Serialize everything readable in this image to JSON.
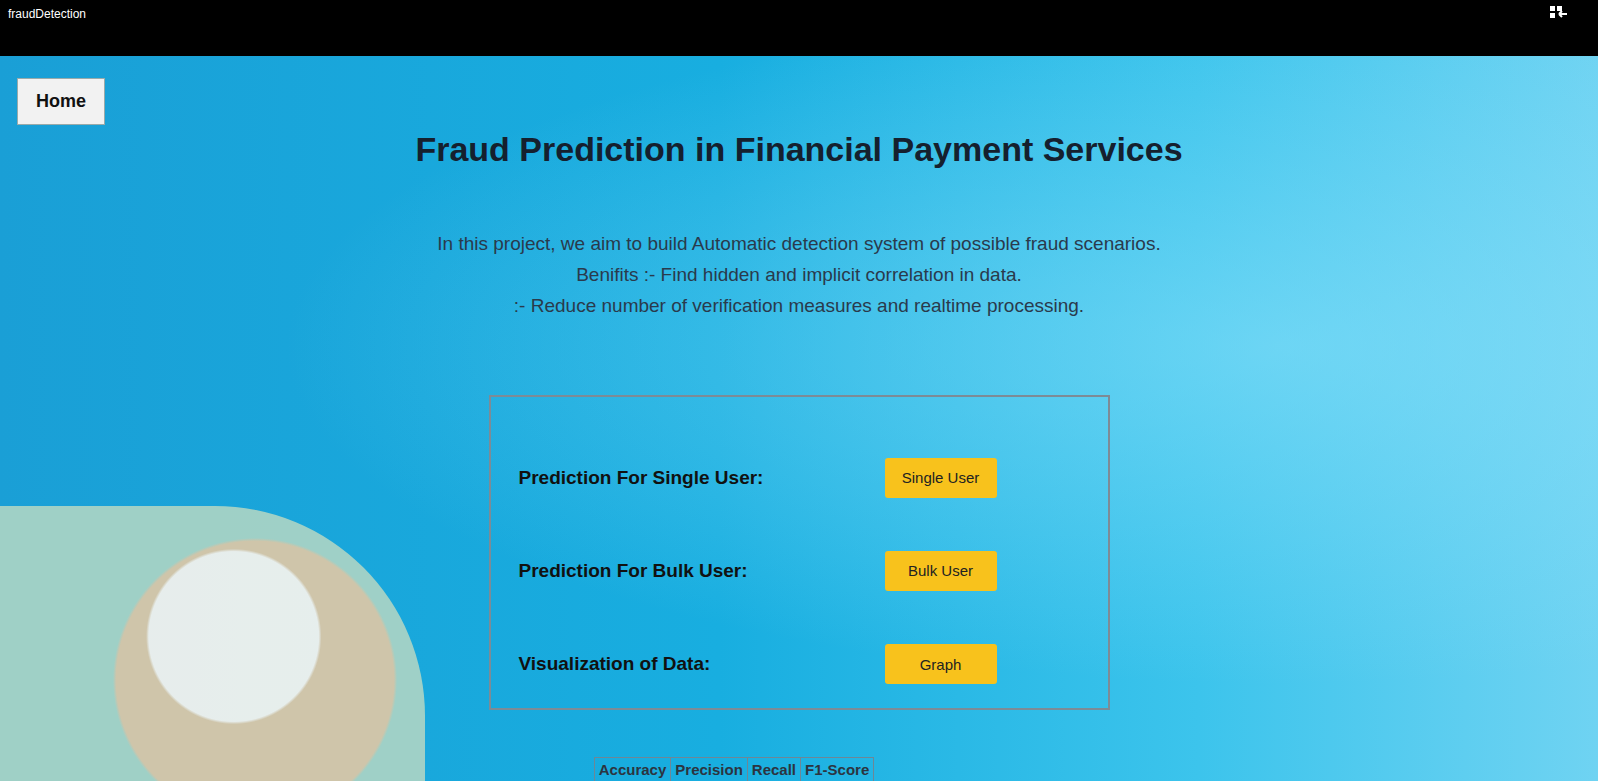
{
  "window": {
    "title": "fraudDetection"
  },
  "home_button": "Home",
  "page_title": "Fraud Prediction in Financial Payment Services",
  "description": [
    "In this project, we aim to build Automatic detection system of possible fraud scenarios.",
    "Benifits :- Find hidden and implicit correlation in data.",
    ":- Reduce number of verification measures and realtime processing."
  ],
  "actions": [
    {
      "label": "Prediction For Single User:",
      "button": "Single User"
    },
    {
      "label": "Prediction For Bulk User:",
      "button": "Bulk User"
    },
    {
      "label": "Visualization of Data:",
      "button": "Graph"
    }
  ],
  "metrics_table": {
    "columns": [
      "Accuracy",
      "Precision",
      "Recall",
      "F1-Score"
    ]
  }
}
